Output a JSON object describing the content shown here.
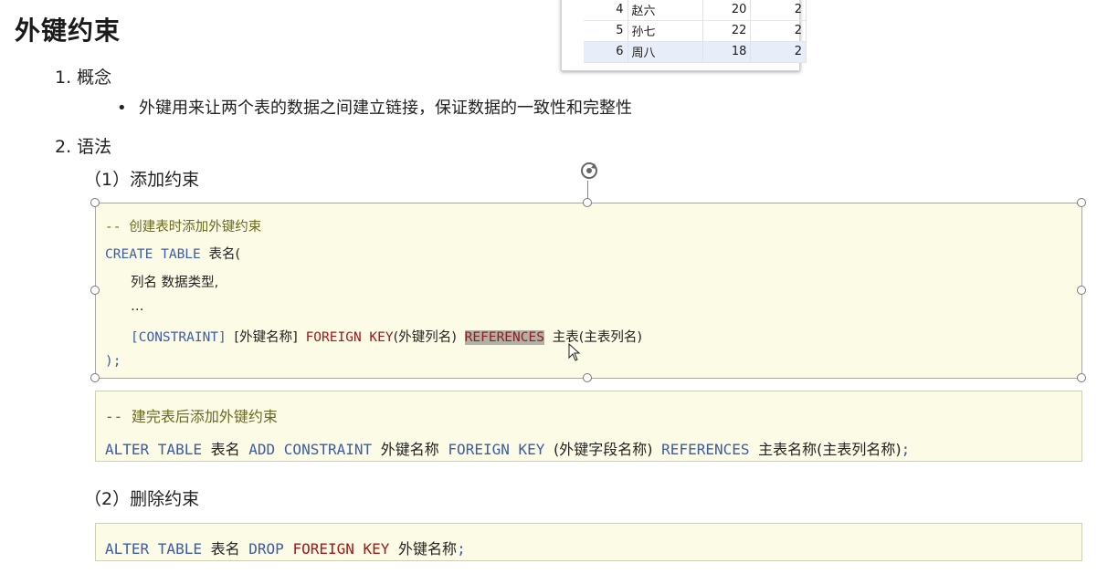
{
  "page_title": "外键约束",
  "section1": {
    "num": "1.",
    "label": "概念"
  },
  "bullet": "外键用来让两个表的数据之间建立链接，保证数据的一致性和完整性",
  "section2": {
    "num": "2.",
    "label": "语法"
  },
  "sub1": "（1）添加约束",
  "sub2": "（2）删除约束",
  "result_table": {
    "rows": [
      {
        "id": "4",
        "name": "赵六",
        "age": "20",
        "dept": "2"
      },
      {
        "id": "5",
        "name": "孙七",
        "age": "22",
        "dept": "2"
      },
      {
        "id": "6",
        "name": "周八",
        "age": "18",
        "dept": "2"
      }
    ]
  },
  "code_block_1": {
    "comment": "-- 创建表时添加外键约束",
    "line2_kw": "CREATE TABLE",
    "line2_tx": "表名(",
    "line3_tx": "列名 数据类型,",
    "line4_tx": "…",
    "line5_constraint": "[CONSTRAINT]",
    "line5_fkname": "[外键名称]",
    "line5_fk": "FOREIGN KEY",
    "line5_fkcol": "(外键列名)",
    "line5_ref": "REFERENCES",
    "line5_main": "主表(主表列名)",
    "line6": ");"
  },
  "code_block_2": {
    "comment": "-- 建完表后添加外键约束",
    "alter": "ALTER TABLE",
    "table": "表名",
    "add": "ADD CONSTRAINT",
    "fkname": "外键名称",
    "fk": "FOREIGN KEY",
    "fkfield": "(外键字段名称)",
    "ref": "REFERENCES",
    "main": "主表名称(主表列名称)",
    "end": ";"
  },
  "code_block_3": {
    "alter": "ALTER TABLE",
    "table": "表名",
    "drop": "DROP",
    "fk": "FOREIGN KEY",
    "fkname": "外键名称",
    "end": ";"
  },
  "colors": {
    "code_bg": "#fcfbe6",
    "keyword_blue": "#3b5ca8",
    "keyword_red": "#a01818",
    "comment": "#6a6a20"
  }
}
